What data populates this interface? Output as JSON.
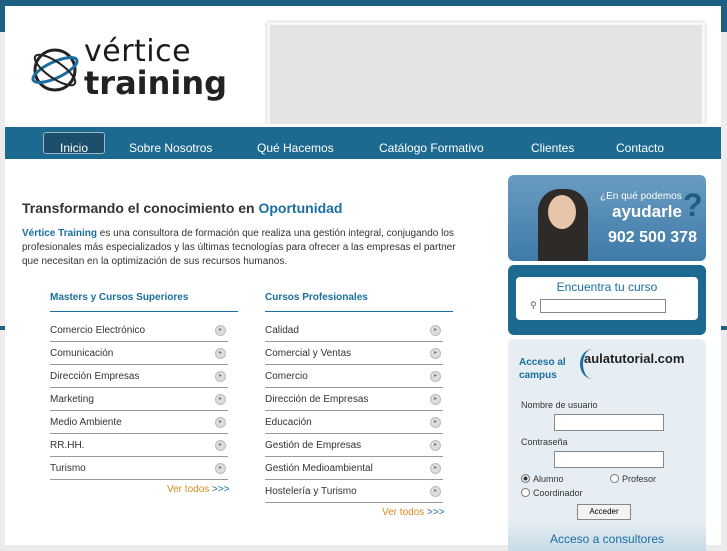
{
  "logo": {
    "line1": "vértice",
    "line2": "training"
  },
  "nav": {
    "items": [
      "Inicio",
      "Sobre Nosotros",
      "Qué Hacemos",
      "Catálogo Formativo",
      "Clientes",
      "Contacto"
    ]
  },
  "main": {
    "heading_pre": "Transformando el conocimiento en ",
    "heading_hl": "Oportunidad",
    "intro_bold": "Vértice Training",
    "intro_rest": " es una consultora de formación que realiza una gestión integral, conjugando los profesionales más especializados y las últimas tecnologías para ofrecer a las empresas el partner que necesitan en la optimización de sus recursos humanos."
  },
  "col1": {
    "title": "Masters y Cursos Superiores",
    "items": [
      "Comercio Electrónico",
      "Comunicación",
      "Dirección Empresas",
      "Marketing",
      "Medio Ambiente",
      "RR.HH.",
      "Turismo"
    ],
    "ver_todos": "Ver todos",
    "gt": ">>>"
  },
  "col2": {
    "title": "Cursos Profesionales",
    "items": [
      "Calidad",
      "Comercial y Ventas",
      "Comercio",
      "Dirección de Empresas",
      "Educación",
      "Gestión de Empresas",
      "Gestión Medioambiental",
      "Hostelería y Turismo"
    ],
    "ver_todos": "Ver todos",
    "gt": ">>>"
  },
  "sidebar": {
    "help_q": "¿En qué podemos",
    "help_q2": "ayudarle",
    "help_mark": "?",
    "phone": "902 500 378",
    "search_title": "Encuentra tu curso",
    "campus_title": "Acceso al campus",
    "aula": "aulatutorial.com",
    "user_label": "Nombre de usuario",
    "pass_label": "Contraseña",
    "role_alumno": "Alumno",
    "role_profesor": "Profesor",
    "role_coordinador": "Coordinador",
    "submit": "Acceder",
    "consult": "Acceso a consultores"
  }
}
